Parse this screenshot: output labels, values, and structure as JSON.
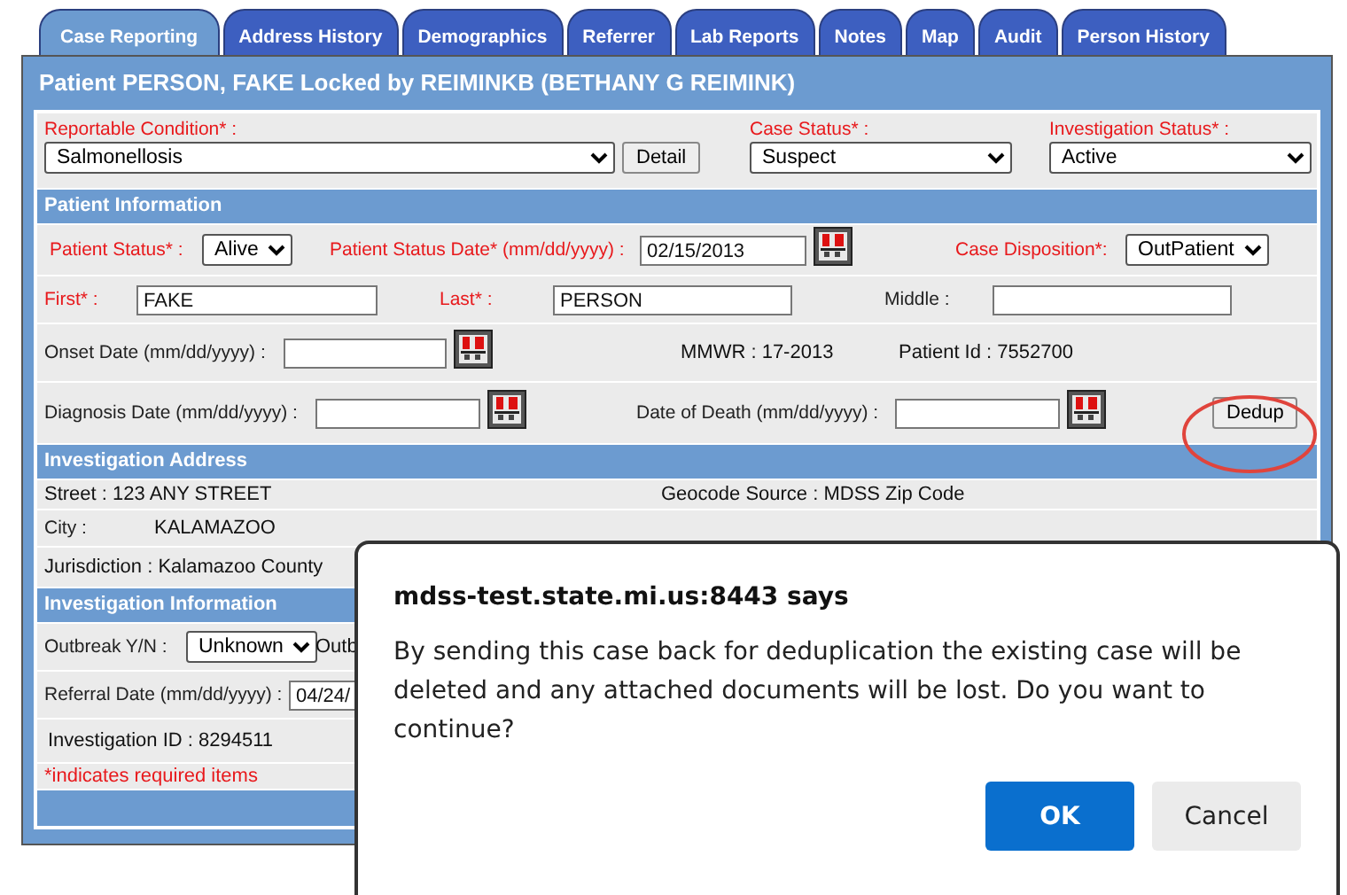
{
  "tabs": [
    {
      "label": "Case Reporting",
      "selected": true
    },
    {
      "label": "Address History",
      "selected": false
    },
    {
      "label": "Demographics",
      "selected": false
    },
    {
      "label": "Referrer",
      "selected": false
    },
    {
      "label": "Lab Reports",
      "selected": false
    },
    {
      "label": "Notes",
      "selected": false
    },
    {
      "label": "Map",
      "selected": false
    },
    {
      "label": "Audit",
      "selected": false
    },
    {
      "label": "Person History",
      "selected": false
    }
  ],
  "title": "Patient PERSON, FAKE Locked by REIMINKB (BETHANY G REIMINK)",
  "top_fields": [
    {
      "label": "Reportable Condition* :",
      "required": true,
      "value": "Salmonellosis",
      "button": "Detail"
    },
    {
      "label": "Case Status* :",
      "required": true,
      "value": "Suspect"
    },
    {
      "label": "Investigation Status* :",
      "required": true,
      "value": "Active"
    }
  ],
  "sections": [
    {
      "title": "Patient Information",
      "rows": [
        {
          "fields": [
            {
              "kind": "select",
              "label": "Patient Status* :",
              "required": true,
              "value": "Alive"
            },
            {
              "kind": "date",
              "label": "Patient Status Date* (mm/dd/yyyy) :",
              "required": true,
              "value": "02/15/2013"
            },
            {
              "kind": "select",
              "label": "Case Disposition*:",
              "required": true,
              "value": "OutPatient"
            }
          ]
        },
        {
          "fields": [
            {
              "kind": "input",
              "label": "First* :",
              "required": true,
              "value": "FAKE"
            },
            {
              "kind": "input",
              "label": "Last* :",
              "required": true,
              "value": "PERSON"
            },
            {
              "kind": "input",
              "label": "Middle :",
              "required": false
            }
          ]
        },
        {
          "fields": [
            {
              "kind": "date",
              "label": "Onset Date (mm/dd/yyyy) :",
              "required": false
            },
            {
              "kind": "text",
              "text": "MMWR :  17-2013"
            },
            {
              "kind": "text",
              "text": "Patient Id :  7552700"
            }
          ]
        },
        {
          "fields": [
            {
              "kind": "date",
              "label": "Diagnosis Date (mm/dd/yyyy) :",
              "required": false
            },
            {
              "kind": "date",
              "label": "Date of Death (mm/dd/yyyy) :",
              "required": false
            },
            {
              "kind": "button",
              "text": "Dedup",
              "highlighted": true
            }
          ]
        }
      ]
    },
    {
      "title": "Investigation Address",
      "rows": [
        {
          "fields": [
            {
              "kind": "text",
              "text": "Street :  123 ANY STREET"
            },
            {
              "kind": "text",
              "text": "Geocode Source :  MDSS Zip Code"
            }
          ]
        },
        {
          "fields": [
            {
              "kind": "pair",
              "label": "City :",
              "text": "KALAMAZOO"
            }
          ]
        },
        {
          "fields": [
            {
              "kind": "text",
              "text": "Jurisdiction :  Kalamazoo County"
            }
          ]
        }
      ]
    },
    {
      "title": "Investigation Information",
      "rows": [
        {
          "fields": [
            {
              "kind": "select",
              "label": "Outbreak Y/N :",
              "required": false,
              "value": "Unknown"
            },
            {
              "kind": "text",
              "text": "Outb"
            }
          ]
        },
        {
          "fields": [
            {
              "kind": "input",
              "label": "Referral Date (mm/dd/yyyy) :",
              "required": false,
              "value": "04/24/"
            }
          ]
        },
        {
          "fields": [
            {
              "kind": "text",
              "text": "Investigation ID :  8294511"
            }
          ]
        }
      ]
    }
  ],
  "footer_note": "*indicates required items",
  "dialog": {
    "title": "mdss-test.state.mi.us:8443 says",
    "message": "By sending this case back for deduplication the existing case will be deleted and any attached documents will be lost.  Do you want to continue?",
    "buttons": [
      {
        "label": "OK",
        "primary": true
      },
      {
        "label": "Cancel",
        "primary": false
      }
    ]
  }
}
